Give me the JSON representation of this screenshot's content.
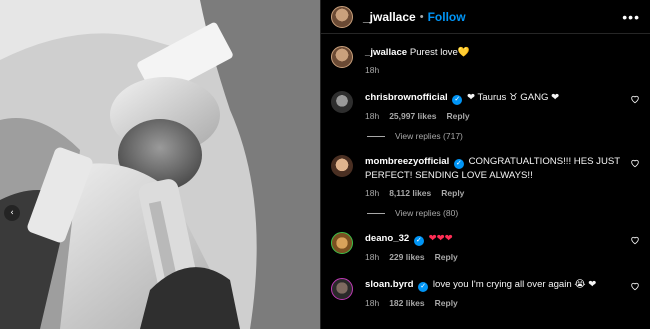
{
  "post": {
    "author": "_jwallace",
    "follow_label": "Follow",
    "separator": "•",
    "more_label": "•••",
    "carousel_indicator": "‹",
    "caption_author": "_jwallace",
    "caption_text": "Purest love💛",
    "caption_time": "18h"
  },
  "comments": [
    {
      "user": "chrisbrownofficial",
      "verified": true,
      "text": "❤ Taurus ♉ GANG ❤",
      "time": "18h",
      "likes": "25,997 likes",
      "reply_label": "Reply",
      "replies": "View replies (717)"
    },
    {
      "user": "mombreezyofficial",
      "verified": true,
      "text": "CONGRATUALTIONS!!! HES JUST PERFECT! SENDING LOVE ALWAYS!!",
      "time": "18h",
      "likes": "8,112 likes",
      "reply_label": "Reply",
      "replies": "View replies (80)"
    },
    {
      "user": "deano_32",
      "verified": true,
      "text": "❤❤❤",
      "time": "18h",
      "likes": "229 likes",
      "reply_label": "Reply"
    },
    {
      "user": "sloan.byrd",
      "verified": true,
      "text": "love you I'm crying all over again 😭 ❤",
      "time": "18h",
      "likes": "182 likes",
      "reply_label": "Reply"
    }
  ],
  "icons": {
    "verified": "✓",
    "like": "heart-outline-icon"
  },
  "colors": {
    "accent": "#0095f6",
    "heart": "#ff2d55",
    "muted": "#a8a8a8"
  }
}
